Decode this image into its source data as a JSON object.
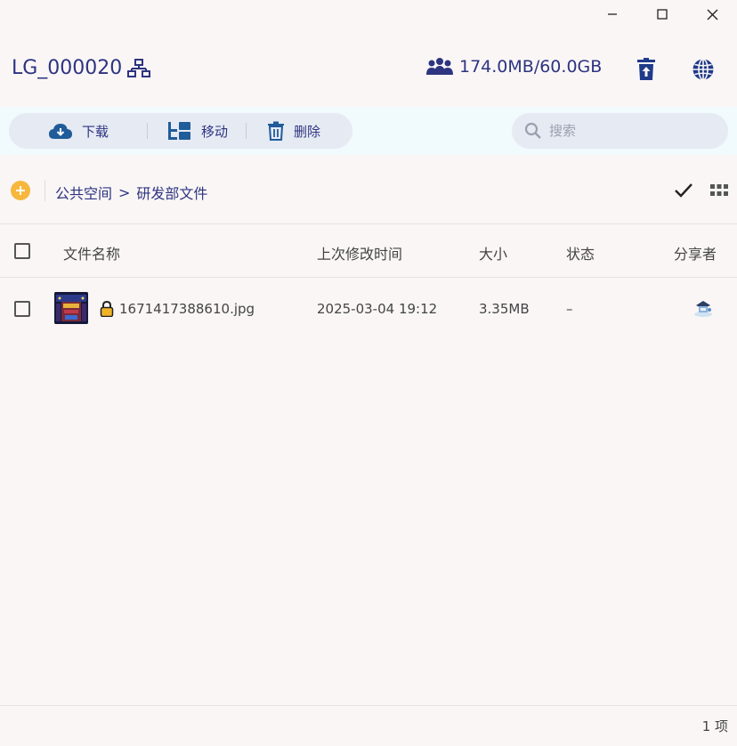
{
  "header": {
    "workspace_name": "LG_000020",
    "storage_usage": "174.0MB/60.0GB"
  },
  "toolbar": {
    "download_label": "下载",
    "move_label": "移动",
    "delete_label": "删除",
    "search_placeholder": "搜索"
  },
  "breadcrumb": {
    "items": [
      "公共空间",
      "研发部文件"
    ],
    "separator": ">"
  },
  "table": {
    "columns": {
      "name": "文件名称",
      "modified": "上次修改时间",
      "size": "大小",
      "status": "状态",
      "sharer": "分享者"
    },
    "rows": [
      {
        "name": "1671417388610.jpg",
        "modified": "2025-03-04 19:12",
        "size": "3.35MB",
        "status": "–",
        "locked": true
      }
    ]
  },
  "footer": {
    "count_label": "1 项"
  },
  "colors": {
    "accent": "#2d3480",
    "icon_blue": "#1f5c99",
    "add_button": "#f6b73c",
    "lock": "#f0b429"
  }
}
